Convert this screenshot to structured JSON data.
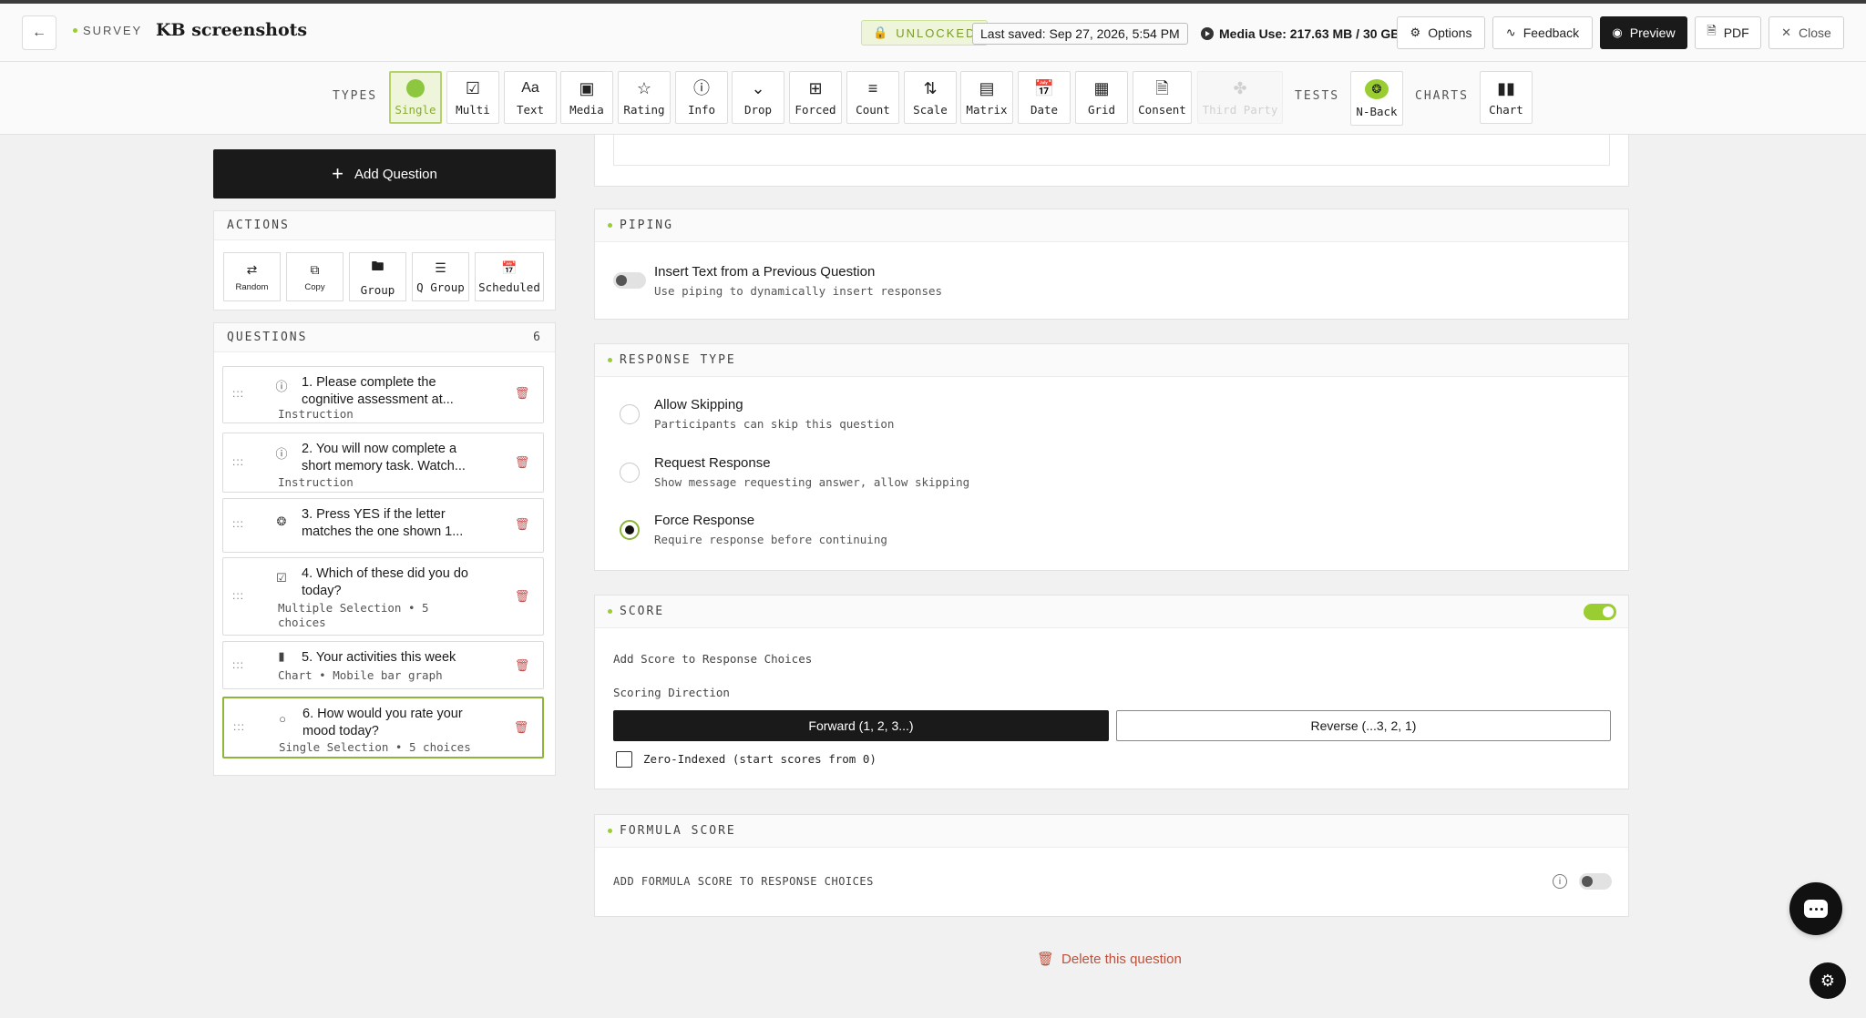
{
  "header": {
    "back_icon": "arrow-left-icon",
    "survey_tag": "SURVEY",
    "title": "KB screenshots",
    "unlocked": "UNLOCKED",
    "last_saved": "Last saved: Sep 27, 2026, 5:54 PM",
    "media_use": "Media Use: 217.63 MB / 30 GB",
    "buttons": {
      "options": "Options",
      "feedback": "Feedback",
      "preview": "Preview",
      "pdf": "PDF",
      "close": "Close"
    }
  },
  "toolbar": {
    "types_label": "TYPES",
    "tests_label": "TESTS",
    "charts_label": "CHARTS",
    "types": [
      {
        "label": "Single",
        "icon": "circle-icon"
      },
      {
        "label": "Multi",
        "icon": "checkbox-icon"
      },
      {
        "label": "Text",
        "icon": "text-icon"
      },
      {
        "label": "Media",
        "icon": "image-icon"
      },
      {
        "label": "Rating",
        "icon": "star-icon"
      },
      {
        "label": "Info",
        "icon": "info-icon"
      },
      {
        "label": "Drop",
        "icon": "chevron-down-icon"
      },
      {
        "label": "Forced",
        "icon": "grid-icon"
      },
      {
        "label": "Count",
        "icon": "list-ordered-icon"
      },
      {
        "label": "Scale",
        "icon": "sliders-icon"
      },
      {
        "label": "Matrix",
        "icon": "table-icon"
      },
      {
        "label": "Date",
        "icon": "calendar-icon"
      },
      {
        "label": "Grid",
        "icon": "grid-table-icon"
      },
      {
        "label": "Consent",
        "icon": "document-icon"
      },
      {
        "label": "Third Party",
        "icon": "plug-icon"
      }
    ],
    "tests": [
      {
        "label": "N-Back",
        "icon": "brain-icon"
      }
    ],
    "charts": [
      {
        "label": "Chart",
        "icon": "bar-chart-icon"
      }
    ]
  },
  "left": {
    "add_question": "Add Question",
    "actions_title": "ACTIONS",
    "actions": [
      "Random",
      "Copy",
      "Group",
      "Q Group",
      "Scheduled"
    ],
    "questions_title": "QUESTIONS",
    "questions_count": "6",
    "questions": [
      {
        "title": "1. Please complete the cognitive assessment at...",
        "sub": "Instruction",
        "icon": "info-icon"
      },
      {
        "title": "2. You will now complete a short memory task. Watch...",
        "sub": "Instruction",
        "icon": "info-icon"
      },
      {
        "title": "3. Press YES if the letter matches the one shown 1...",
        "sub": "",
        "icon": "brain-icon"
      },
      {
        "title": "4. Which of these did you do today?",
        "sub": "Multiple Selection • 5 choices",
        "icon": "checkbox-icon"
      },
      {
        "title": "5. Your activities this week",
        "sub": "Chart • Mobile bar graph",
        "icon": "bar-chart-icon"
      },
      {
        "title": "6. How would you rate your mood today?",
        "sub": "Single Selection • 5 choices",
        "icon": "circle-icon"
      }
    ]
  },
  "piping": {
    "title": "PIPING",
    "option_title": "Insert Text from a Previous Question",
    "option_desc": "Use piping to dynamically insert responses",
    "enabled": false
  },
  "response_type": {
    "title": "RESPONSE TYPE",
    "options": [
      {
        "title": "Allow Skipping",
        "desc": "Participants can skip this question",
        "selected": false
      },
      {
        "title": "Request Response",
        "desc": "Show message requesting answer, allow skipping",
        "selected": false
      },
      {
        "title": "Force Response",
        "desc": "Require response before continuing",
        "selected": true
      }
    ]
  },
  "score": {
    "title": "SCORE",
    "enabled": true,
    "add_label": "Add Score to Response Choices",
    "direction_label": "Scoring Direction",
    "forward": "Forward (1, 2, 3...)",
    "reverse": "Reverse (...3, 2, 1)",
    "zero_indexed": "Zero-Indexed (start scores from 0)"
  },
  "formula": {
    "title": "FORMULA SCORE",
    "label": "ADD FORMULA SCORE TO RESPONSE CHOICES",
    "enabled": false
  },
  "delete_question": "Delete this question",
  "colors": {
    "accent": "#8dc63f",
    "dark": "#1a1a1a",
    "danger": "#c0503a"
  }
}
